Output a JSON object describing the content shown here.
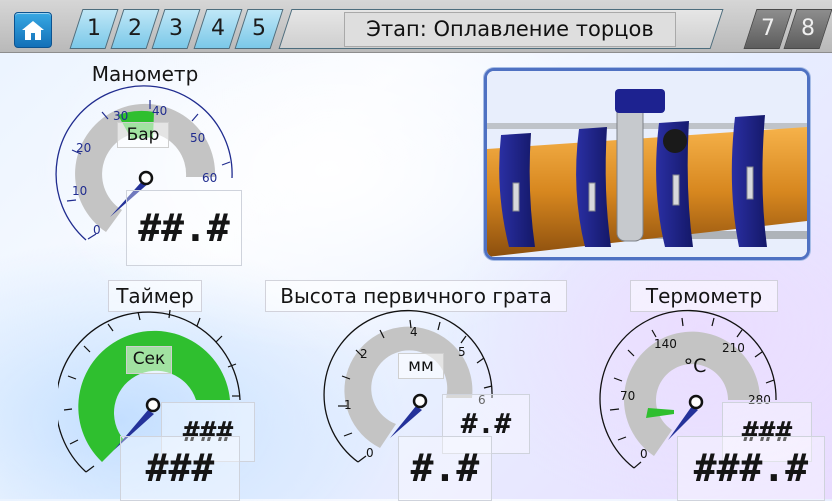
{
  "topbar": {
    "tabs": [
      "1",
      "2",
      "3",
      "4",
      "5"
    ],
    "stage_title": "Этап: Оплавление торцов",
    "right_tabs": [
      "7",
      "8"
    ]
  },
  "manometer": {
    "title": "Манометр",
    "unit": "Бар",
    "scale_labels": [
      "0",
      "10",
      "20",
      "30",
      "40",
      "50",
      "60"
    ],
    "readout": "##.#"
  },
  "timer": {
    "title": "Таймер",
    "unit": "Сек",
    "readout_small": "###",
    "readout_large": "###"
  },
  "burr_height": {
    "title": "Высота первичного грата",
    "unit": "мм",
    "scale_labels": [
      "0",
      "1",
      "2",
      "4",
      "5",
      "6"
    ],
    "readout_small": "#.#",
    "readout_large": "#.#"
  },
  "thermometer": {
    "title": "Термометр",
    "unit": "°C",
    "scale_labels": [
      "0",
      "70",
      "140",
      "210",
      "280"
    ],
    "readout_small": "###",
    "readout_large": "###.#"
  },
  "colors": {
    "accent_green": "#2fbf2f",
    "gauge_gray": "#c4c4c4",
    "needle_blue": "#24329a",
    "scale_blue": "#202c8f"
  }
}
